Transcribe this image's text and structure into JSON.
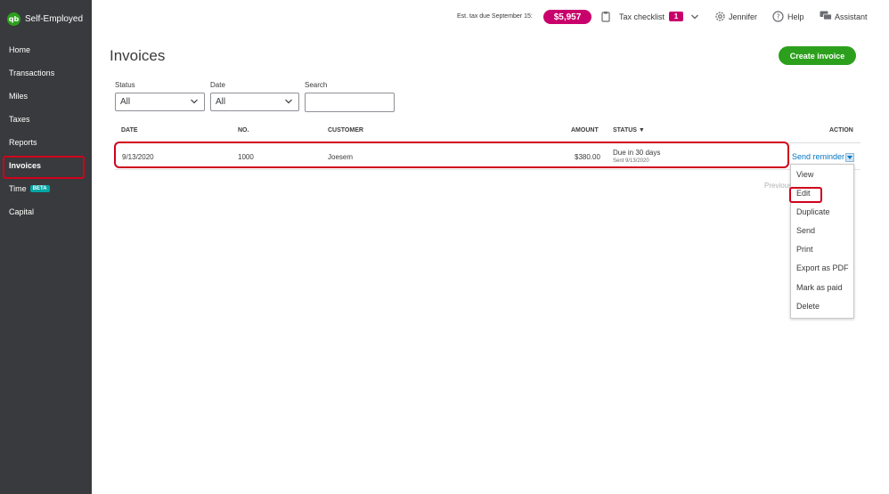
{
  "brand": {
    "name": "Self-Employed",
    "logo_text": "qb"
  },
  "sidebar": {
    "items": [
      {
        "label": "Home"
      },
      {
        "label": "Transactions"
      },
      {
        "label": "Miles"
      },
      {
        "label": "Taxes"
      },
      {
        "label": "Reports"
      },
      {
        "label": "Invoices",
        "active": true
      },
      {
        "label": "Time",
        "badge": "BETA"
      },
      {
        "label": "Capital"
      }
    ]
  },
  "topbar": {
    "est_tax_label": "Est. tax due September 15:",
    "est_tax_value": "$5,957",
    "tax_checklist_label": "Tax checklist",
    "tax_checklist_count": "1",
    "user_name": "Jennifer",
    "help_label": "Help",
    "assistant_label": "Assistant"
  },
  "page": {
    "title": "Invoices",
    "create_button": "Create invoice"
  },
  "filters": {
    "status_label": "Status",
    "status_value": "All",
    "date_label": "Date",
    "date_value": "All",
    "search_label": "Search",
    "search_value": ""
  },
  "table": {
    "columns": [
      "DATE",
      "NO.",
      "CUSTOMER",
      "AMOUNT",
      "STATUS ▼",
      "ACTION"
    ],
    "rows": [
      {
        "date": "9/13/2020",
        "no": "1000",
        "customer": "Joesem",
        "amount": "$380.00",
        "status": "Due in 30 days",
        "status_sub": "Sent 9/13/2020",
        "action": "Send reminder"
      }
    ],
    "pagination_previous": "Previous"
  },
  "action_menu": {
    "items": [
      "View",
      "Edit",
      "Duplicate",
      "Send",
      "Print",
      "Export as PDF",
      "Mark as paid",
      "Delete"
    ]
  },
  "colors": {
    "brand_green": "#2ca01c",
    "sidebar_bg": "#393a3d",
    "tax_pill": "#c9006b",
    "highlight_red": "#d0021b",
    "link_blue": "#0077c5"
  }
}
